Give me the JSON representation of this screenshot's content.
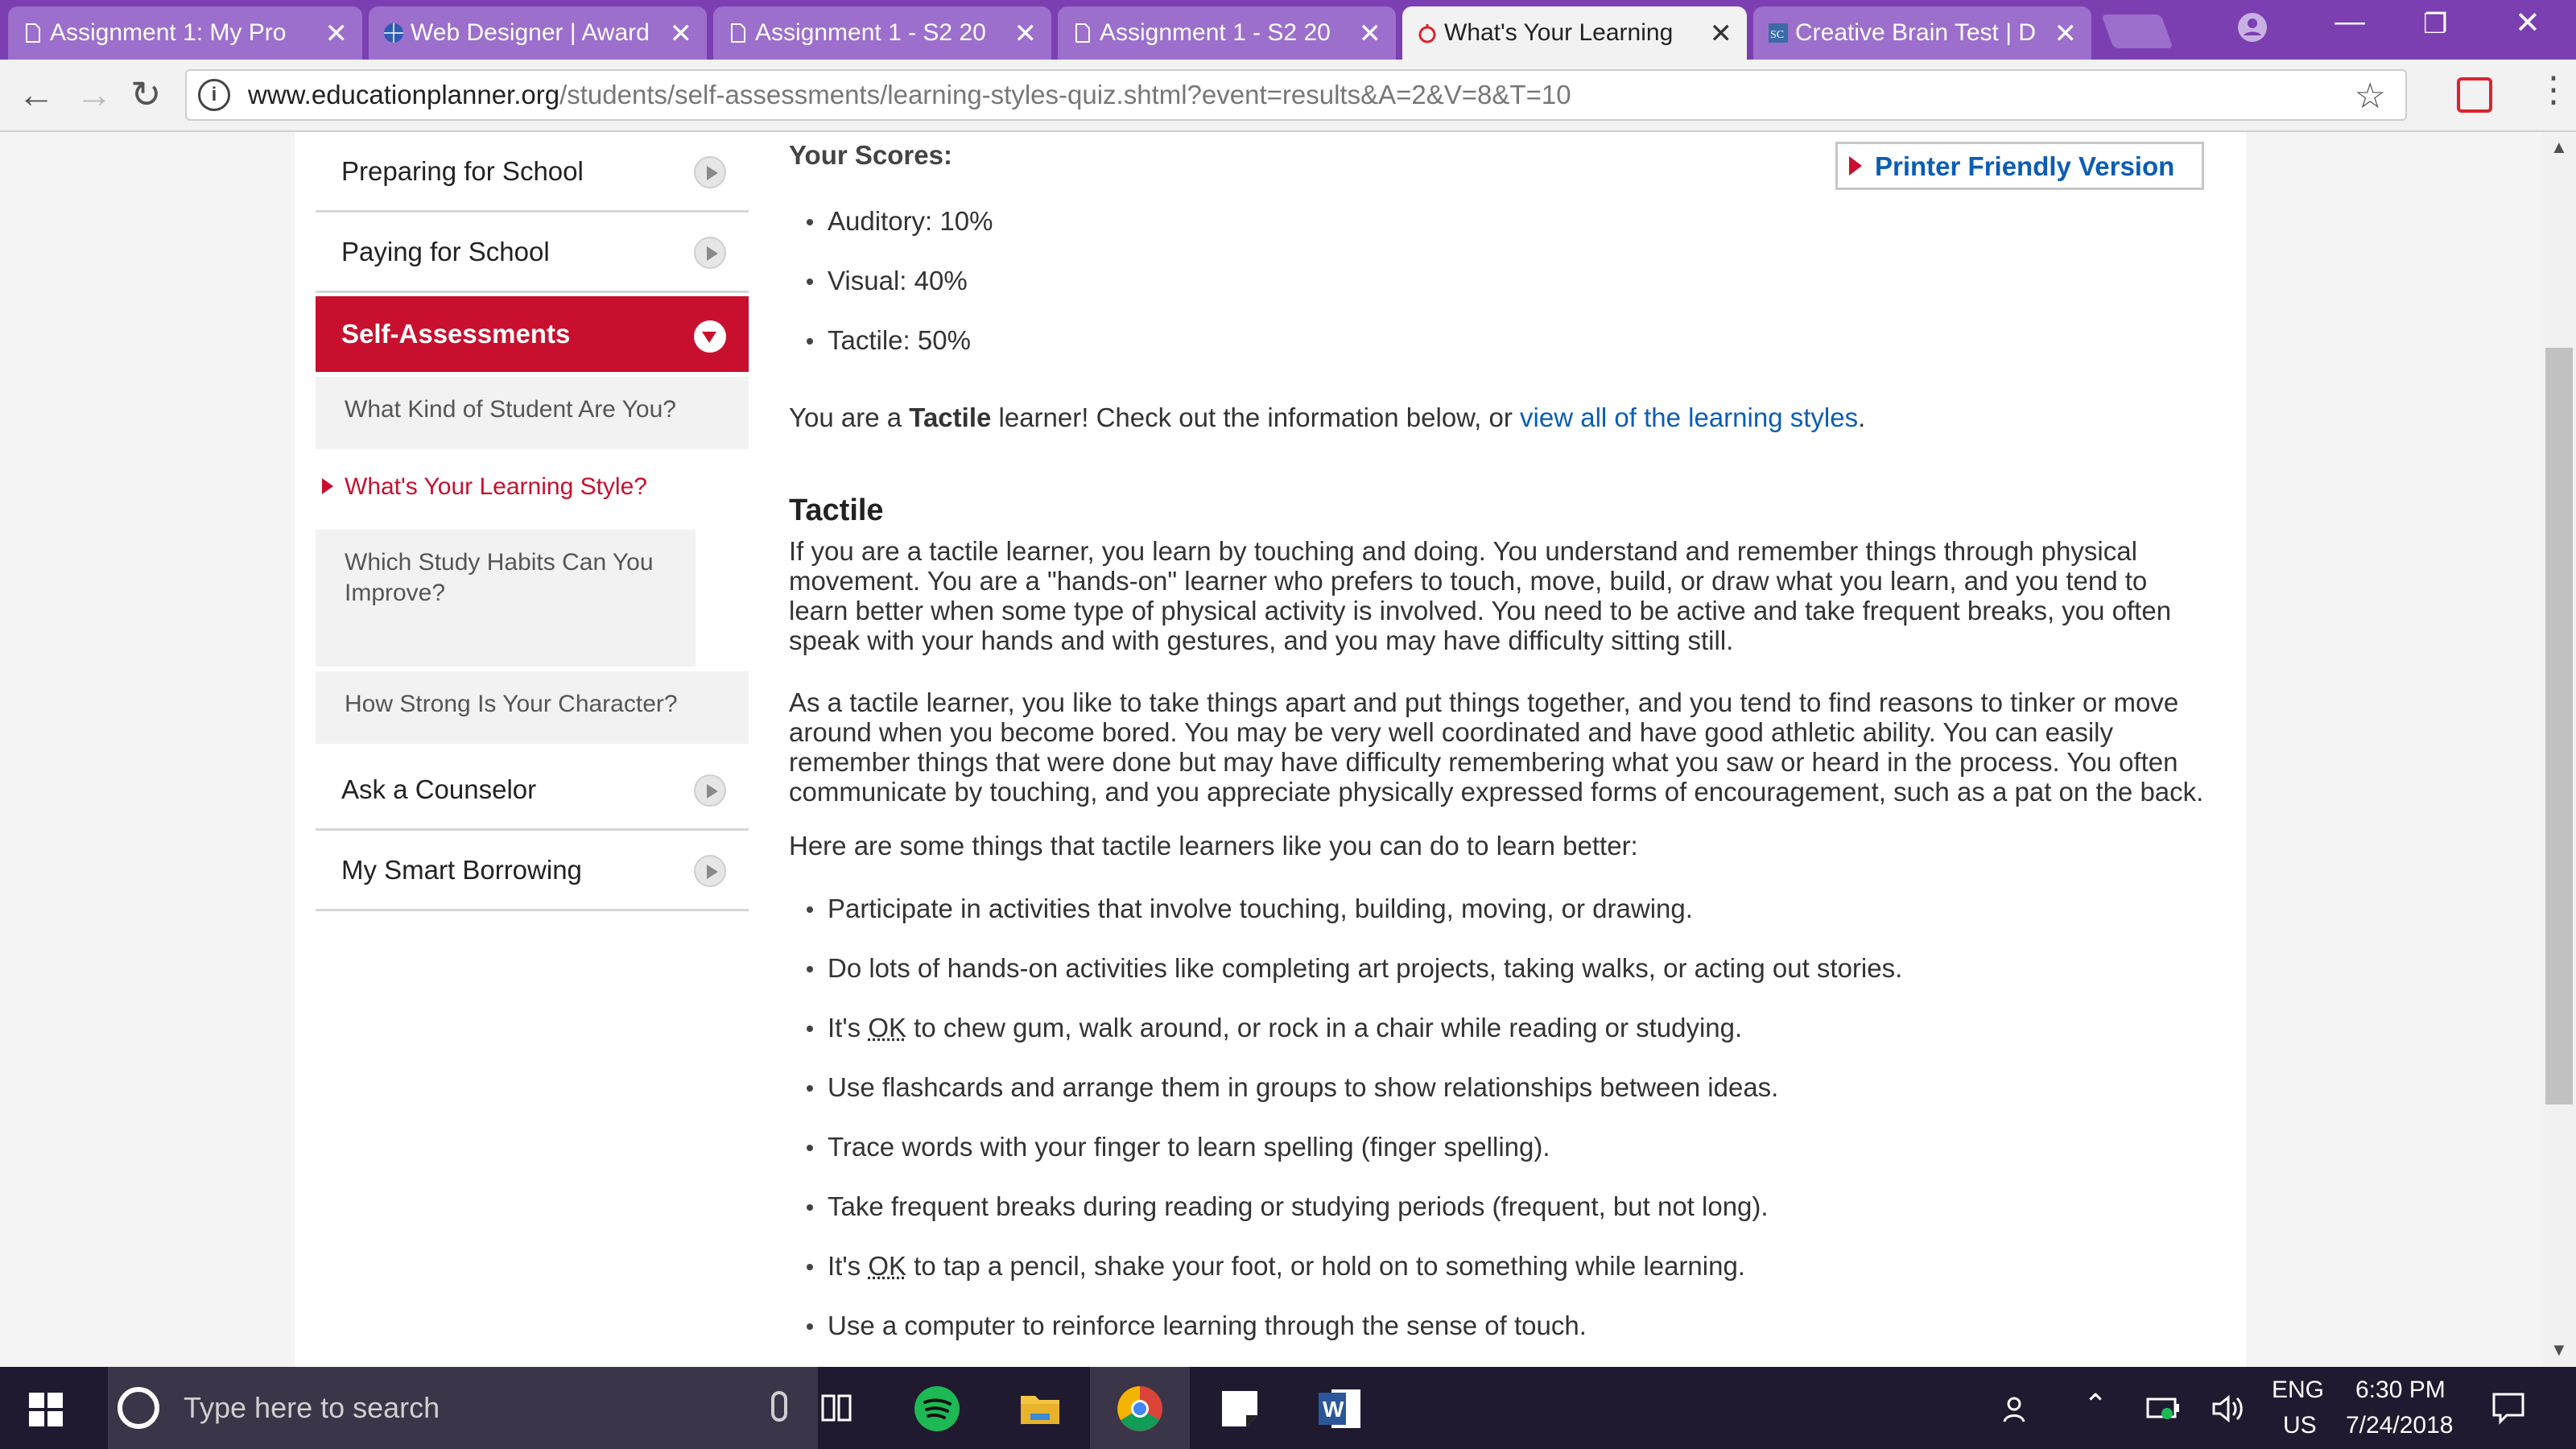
{
  "browser": {
    "tabs": [
      {
        "title": "Assignment 1: My Pro",
        "active": false
      },
      {
        "title": "Web Designer | Award",
        "active": false
      },
      {
        "title": "Assignment 1 - S2 20",
        "active": false
      },
      {
        "title": "Assignment 1 - S2 20",
        "active": false
      },
      {
        "title": "What's Your Learning",
        "active": true
      },
      {
        "title": "Creative Brain Test | D",
        "active": false
      }
    ],
    "url_host": "www.educationplanner.org",
    "url_path": "/students/self-assessments/learning-styles-quiz.shtml?event=results&A=2&V=8&T=10",
    "accent_color": "#7b3fb2"
  },
  "sidebar": {
    "items": [
      {
        "label": "Preparing for School"
      },
      {
        "label": "Paying for School"
      },
      {
        "label": "Self-Assessments"
      },
      {
        "label": "Ask a Counselor"
      },
      {
        "label": "My Smart Borrowing"
      }
    ],
    "sub_items": [
      {
        "label": "What Kind of Student Are You?"
      },
      {
        "label": "What's Your Learning Style?"
      },
      {
        "label": "Which Study Habits Can You Improve?"
      },
      {
        "label": "How Strong Is Your Character?"
      }
    ]
  },
  "main": {
    "scores_title": "Your Scores:",
    "printer_label": "Printer Friendly Version",
    "scores": [
      "Auditory: 10%",
      "Visual: 40%",
      "Tactile: 50%"
    ],
    "result_prefix": "You are a ",
    "result_style": "Tactile",
    "result_mid": " learner! Check out the information below, or ",
    "result_link": "view all of the learning styles",
    "result_end": ".",
    "section_heading": "Tactile",
    "para1": "If you are a tactile learner, you learn by touching and doing. You understand and remember things through physical movement. You are a \"hands-on\" learner who prefers to touch, move, build, or draw what you learn, and you tend to learn better when some type of physical activity is involved. You need to be active and take frequent breaks, you often speak with your hands and with gestures, and you may have difficulty sitting still.",
    "para2": "As a tactile learner, you like to take things apart and put things together, and you tend to find reasons to tinker or move around when you become bored. You may be very well coordinated and have good athletic ability. You can easily remember things that were done but may have difficulty remembering what you saw or heard in the process. You often communicate by touching, and you appreciate physically expressed forms of encouragement, such as a pat on the back.",
    "para3": "Here are some things that tactile learners like you can do to learn better:",
    "tips": [
      {
        "pre": "Participate in activities that involve touching, building, moving, or drawing.",
        "abbr": "",
        "post": ""
      },
      {
        "pre": "Do lots of hands-on activities like completing art projects, taking walks, or acting out stories.",
        "abbr": "",
        "post": ""
      },
      {
        "pre": "It's ",
        "abbr": "OK",
        "post": " to chew gum, walk around, or rock in a chair while reading or studying."
      },
      {
        "pre": "Use flashcards and arrange them in groups to show relationships between ideas.",
        "abbr": "",
        "post": ""
      },
      {
        "pre": "Trace words with your finger to learn spelling (finger spelling).",
        "abbr": "",
        "post": ""
      },
      {
        "pre": "Take frequent breaks during reading or studying periods (frequent, but not long).",
        "abbr": "",
        "post": ""
      },
      {
        "pre": "It's ",
        "abbr": "OK",
        "post": " to tap a pencil, shake your foot, or hold on to something while learning."
      },
      {
        "pre": "Use a computer to reinforce learning through the sense of touch.",
        "abbr": "",
        "post": ""
      }
    ]
  },
  "taskbar": {
    "search_placeholder": "Type here to search",
    "language": "ENG",
    "region": "US",
    "time": "6:30 PM",
    "date": "7/24/2018"
  }
}
